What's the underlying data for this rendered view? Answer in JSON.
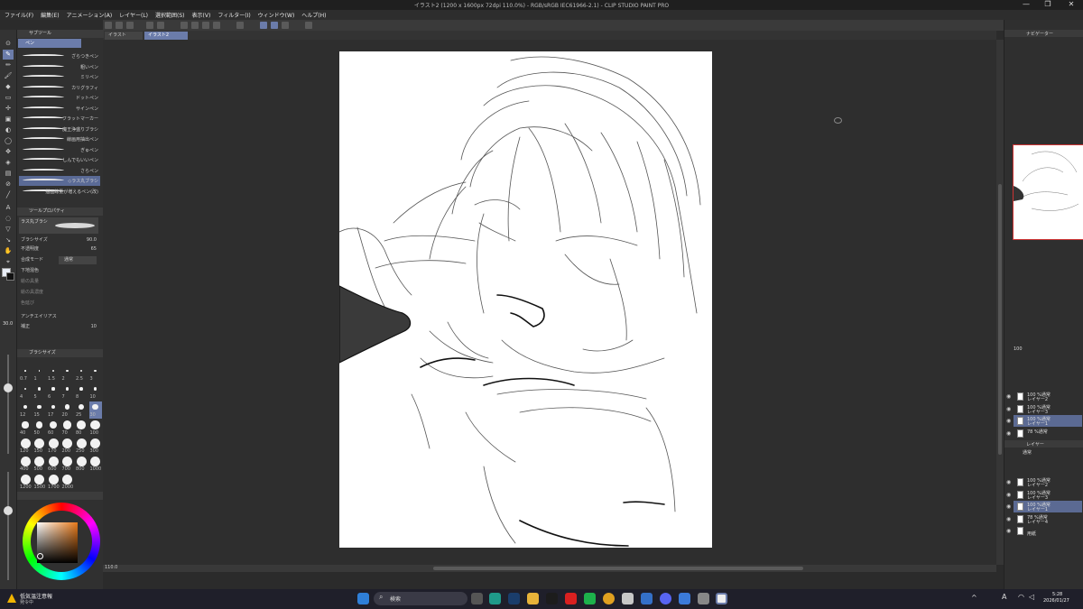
{
  "app": {
    "title": "イラスト2 (1200 x 1600px 72dpi 110.0%)  - RGB/sRGB IEC61966-2.1) - CLIP STUDIO PAINT PRO",
    "menu": [
      "ファイル(F)",
      "編集(E)",
      "アニメーション(A)",
      "レイヤー(L)",
      "選択範囲(S)",
      "表示(V)",
      "フィルター(I)",
      "ウィンドウ(W)",
      "ヘルプ(H)"
    ],
    "tabs": [
      "イラスト",
      "イラスト2"
    ],
    "window_controls": [
      "—",
      "❐",
      "✕"
    ]
  },
  "subtool": {
    "tab_label": "サブツール",
    "group_label": "ペン",
    "brushes": [
      "ざらつきペン",
      "粗いペン",
      "ミリペン",
      "カリグラフィ",
      "ドットペン",
      "サインペン",
      "フラットマーカー",
      "魔王浄盛りブラシ",
      "線画用抽出ペン",
      "ぎゅペン",
      "しんでもいいペン",
      "さらペン",
      "◇ラス丸ブラシ",
      "描画線量が増えるペン(改)"
    ],
    "selected_brush_index": 12
  },
  "tool_property": {
    "header": "ツールプロパティ",
    "brush_name": "ラス丸ブラシ",
    "brush_size_label": "ブラシサイズ",
    "brush_size_value": "90.0",
    "opacity_label": "不透明度",
    "opacity_value": "65",
    "blend_label": "合成モード",
    "blend_value": "通常",
    "underlay_label": "下地混色",
    "paint_amount_label": "絵の具量",
    "paint_density_label": "絵の具濃度",
    "color_stretch_label": "色延び",
    "antialias_label": "アンチエイリアス",
    "stabilization_label": "補正",
    "stabilization_value": "10"
  },
  "brush_size_palette": {
    "header": "ブラシサイズ",
    "sizes": [
      "0.7",
      "1",
      "1.5",
      "2",
      "2.5",
      "3",
      "4",
      "5",
      "6",
      "7",
      "8",
      "10",
      "12",
      "15",
      "17",
      "20",
      "25",
      "30",
      "40",
      "50",
      "60",
      "70",
      "80",
      "100",
      "120",
      "150",
      "170",
      "200",
      "250",
      "300",
      "400",
      "500",
      "600",
      "700",
      "800",
      "1000",
      "1200",
      "1500",
      "1700",
      "2000"
    ],
    "selected": "30"
  },
  "status": {
    "zoom": "110.0",
    "brush_size_readout": "30.0"
  },
  "layers": {
    "group1": [
      {
        "blend": "100 %通常",
        "name": "レイヤー2",
        "selected": false
      },
      {
        "blend": "100 %通常",
        "name": "レイヤー3",
        "selected": false
      },
      {
        "blend": "100 %通常",
        "name": "レイヤー1",
        "selected": true
      },
      {
        "blend": "78 %通常",
        "name": "",
        "selected": false
      }
    ],
    "tab": "レイヤー",
    "group2": [
      {
        "blend": "100 %通常",
        "name": "レイヤー2",
        "selected": false
      },
      {
        "blend": "100 %通常",
        "name": "レイヤー3",
        "selected": false
      },
      {
        "blend": "100 %通常",
        "name": "レイヤー1",
        "selected": true
      },
      {
        "blend": "78 %通常",
        "name": "レイヤー4",
        "selected": false
      },
      {
        "blend": "",
        "name": "用紙",
        "selected": false
      }
    ],
    "opacity_readout": "100",
    "blend_mode": "通常"
  },
  "navigator": {
    "header": "ナビゲーター"
  },
  "taskbar": {
    "weather_title": "低気温注意報",
    "weather_sub": "発令中",
    "search_placeholder": "検索",
    "time": "5:28",
    "date": "2026/01/27",
    "ime": "A"
  },
  "colors": {
    "accent": "#6b7caa",
    "main_color": "#e9eef7",
    "sub_color": "#111111"
  }
}
